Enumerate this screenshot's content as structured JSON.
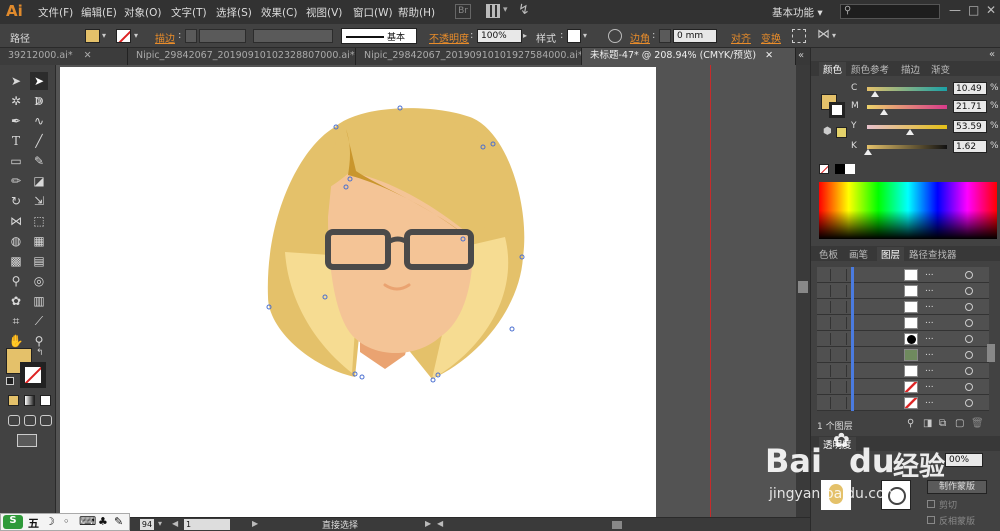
{
  "app": {
    "logo": "Ai"
  },
  "menu": [
    "文件(F)",
    "编辑(E)",
    "对象(O)",
    "文字(T)",
    "选择(S)",
    "效果(C)",
    "视图(V)",
    "窗口(W)",
    "帮助(H)"
  ],
  "menu_icons": {
    "br": "Br"
  },
  "workspace": {
    "label": "基本功能",
    "arrow": "▾"
  },
  "window_controls": {
    "minimize": "—",
    "maximize": "□",
    "close": "✕"
  },
  "control": {
    "object_type": "路径",
    "stroke_label": "描边",
    "stroke_style": "基本",
    "opacity_label": "不透明度",
    "opacity_value": "100%",
    "style_label": "样式",
    "corner_label": "边角",
    "corner_value": "0 mm",
    "align_label": "对齐",
    "transform_label": "变换",
    "fill_color": "#e4c16a"
  },
  "tabs": [
    "39212000.ai*",
    "Nipic_29842067_20190910102328807000.ai*",
    "Nipic_29842067_20190910101927584000.ai*",
    "未标题-47* @ 208.94% (CMYK/预览)"
  ],
  "tab_close": "✕",
  "panel_arrows": "«",
  "color_panel": {
    "tabs": [
      "颜色",
      "颜色参考",
      "描边",
      "渐变"
    ],
    "sliders": [
      {
        "label": "C",
        "value": "10.49",
        "pos": 0.105
      },
      {
        "label": "M",
        "value": "21.71",
        "pos": 0.217
      },
      {
        "label": "Y",
        "value": "53.59",
        "pos": 0.536
      },
      {
        "label": "K",
        "value": "1.62",
        "pos": 0.016
      }
    ],
    "pct": "%"
  },
  "layers_panel": {
    "tabs": [
      "色板",
      "画笔",
      "图层",
      "路径查找器"
    ],
    "rows_dots": "...",
    "row_count": 9,
    "footer": "1 个图层"
  },
  "bottom_panel": {
    "tabs": [
      "透明度"
    ],
    "opacity": "00%",
    "make_mask": "制作蒙版",
    "clip": "剪切",
    "invert": "反相蒙版"
  },
  "status": {
    "zoom": "94",
    "page": "1",
    "tool": "直接选择",
    "play": "▶",
    "left": "◀"
  },
  "ime": {
    "label": "五",
    "keyboard": "⌨"
  },
  "watermark": {
    "brand": "Bai",
    "paw": "du",
    "cn": "经验",
    "url": "jingyan.baidu.com"
  },
  "colors": {
    "hair": "#e4c16a",
    "hair_light": "#f6dc92",
    "skin": "#f4c496",
    "skin_shadow": "#eaa371",
    "glasses": "#4a4a4a",
    "anchor": "#4a6fd0"
  }
}
